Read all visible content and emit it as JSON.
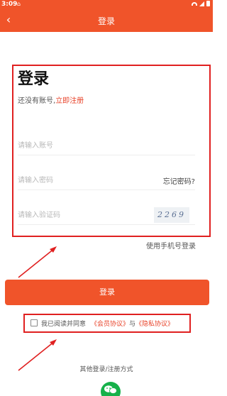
{
  "status_bar": {
    "time": "3:09"
  },
  "header": {
    "title": "登录",
    "back_icon": "‹"
  },
  "form": {
    "heading": "登录",
    "no_account_text": "还没有账号,",
    "register_link": "立即注册",
    "account_placeholder": "请输入账号",
    "password_placeholder": "请输入密码",
    "forgot_password": "忘记密码?",
    "captcha_placeholder": "请输入验证码",
    "captcha_text": "2269"
  },
  "phone_login_link": "使用手机号登录",
  "login_button": "登录",
  "agreement": {
    "prefix": "我已阅读并同意",
    "member_agreement": "《会员协议》",
    "and": "与",
    "privacy_policy": "《隐私协议》",
    "checked": false
  },
  "other_login_label": "其他登录/注册方式",
  "colors": {
    "brand": "#f0542a",
    "annotation": "#e02020",
    "link": "#e8432a",
    "wechat": "#16b14a"
  }
}
